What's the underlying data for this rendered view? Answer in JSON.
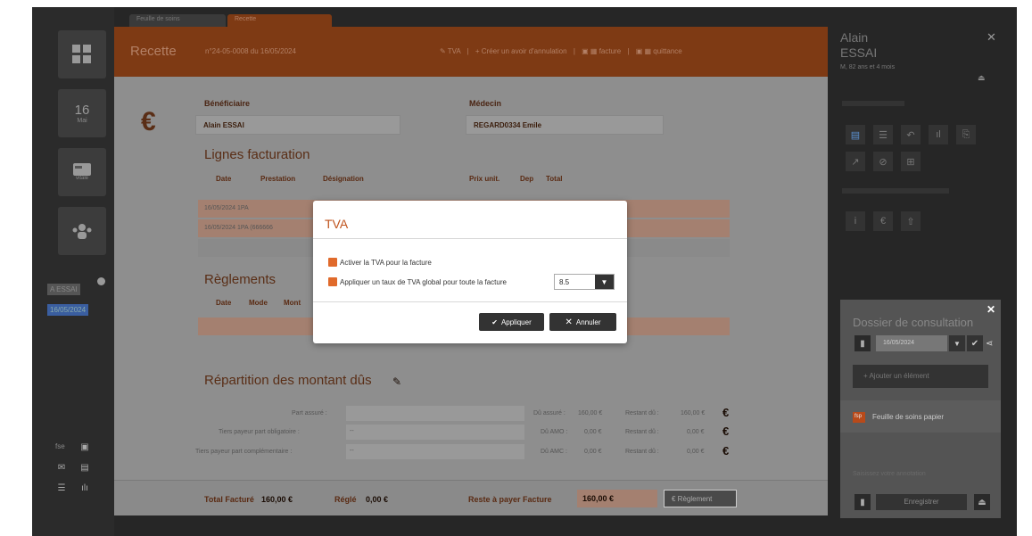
{
  "tabs": [
    "Feuille de soins",
    "Recette"
  ],
  "left_rail": {
    "day": "16",
    "month": "Mai",
    "card_label": "vitale",
    "patient_initials": "A ESSAI",
    "patient_date": "16/05/2024"
  },
  "header": {
    "title": "Recette",
    "subtitle": "n°24-05-0008 du 16/05/2024",
    "tva": "TVA",
    "create_avoir": "Créer un avoir d'annulation",
    "facture": "facture",
    "quittance": "quittance"
  },
  "beneficiaire": {
    "label": "Bénéficiaire",
    "value": "Alain ESSAI"
  },
  "medecin": {
    "label": "Médecin",
    "value": "REGARD0334 Emile"
  },
  "lignes": {
    "title": "Lignes facturation",
    "headers": [
      "Date",
      "Prestation",
      "Désignation",
      "Prix unit.",
      "Dep",
      "Total"
    ],
    "rows": [
      "16/05/2024 1PA",
      "16/05/2024 1PA (666666"
    ]
  },
  "reglements": {
    "title": "Règlements",
    "headers": [
      "Date",
      "Mode",
      "Mont"
    ]
  },
  "repartition": {
    "title": "Répartition des montant dûs",
    "rows": [
      {
        "label": "Part assuré :",
        "value": "",
        "du_label": "Dû assuré :",
        "du": "160,00 €",
        "restant_label": "Restant dû :",
        "restant": "160,00 €"
      },
      {
        "label": "Tiers payeur part obligatoire :",
        "value": "--",
        "du_label": "Dû AMO :",
        "du": "0,00 €",
        "restant_label": "Restant dû :",
        "restant": "0,00 €"
      },
      {
        "label": "Tiers payeur part complémentaire :",
        "value": "--",
        "du_label": "Dû AMC :",
        "du": "0,00 €",
        "restant_label": "Restant dû :",
        "restant": "0,00 €"
      }
    ]
  },
  "footer": {
    "total_label": "Total Facturé",
    "total": "160,00 €",
    "regle_label": "Réglé",
    "regle": "0,00 €",
    "reste_label": "Reste à payer Facture",
    "reste": "160,00 €",
    "reglement_btn": "Règlement"
  },
  "modal": {
    "title": "TVA",
    "opt1": "Activer la TVA pour la facture",
    "opt2": "Appliquer un taux de TVA global pour toute la facture",
    "rate": "8.5",
    "apply": "Appliquer",
    "cancel": "Annuler"
  },
  "patient": {
    "first": "Alain",
    "last": "ESSAI",
    "info": "M, 82 ans et 4 mois"
  },
  "dossier": {
    "title": "Dossier de consultation",
    "date": "16/05/2024",
    "add": "Ajouter un élément",
    "item_badge": "fsp",
    "item": "Feuille de soins papier",
    "note_placeholder": "Saisissez votre annotation",
    "save": "Enregistrer"
  },
  "colors": {
    "accent": "#e06a2b",
    "header": "#7e3a14"
  }
}
